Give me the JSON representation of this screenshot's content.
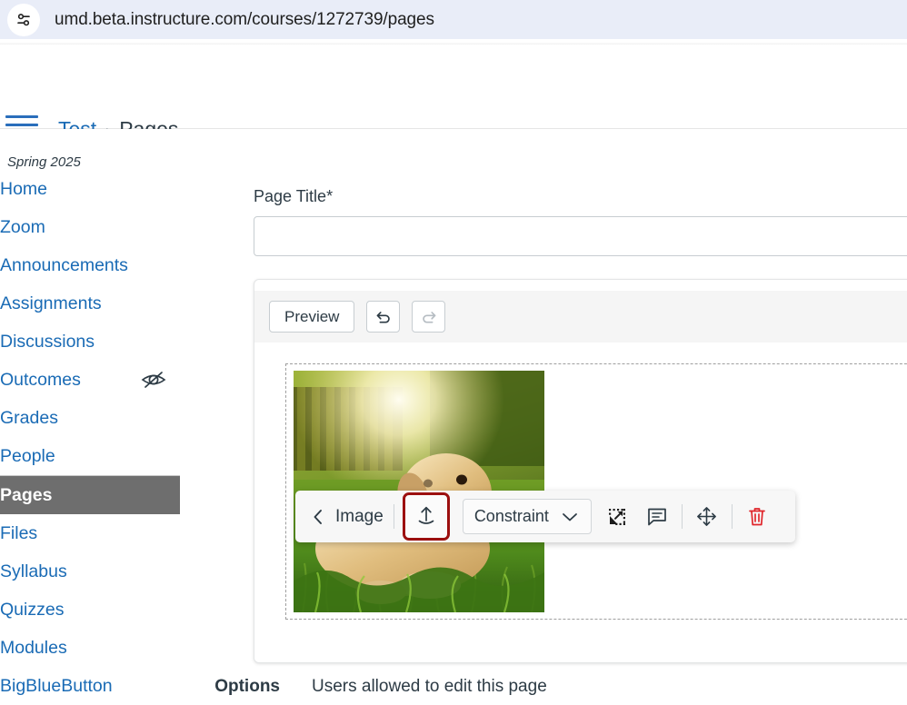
{
  "browser": {
    "site_settings_icon": "sliders-icon",
    "url": "umd.beta.instructure.com/courses/1272739/pages"
  },
  "header": {
    "menu_icon": "hamburger-icon",
    "breadcrumb": {
      "course": "Test",
      "separator": "›",
      "current": "Pages"
    }
  },
  "sidebar": {
    "term": "Spring 2025",
    "items": [
      {
        "label": "Home",
        "active": false,
        "hidden_icon": false
      },
      {
        "label": "Zoom",
        "active": false,
        "hidden_icon": false
      },
      {
        "label": "Announcements",
        "active": false,
        "hidden_icon": false
      },
      {
        "label": "Assignments",
        "active": false,
        "hidden_icon": false
      },
      {
        "label": "Discussions",
        "active": false,
        "hidden_icon": false
      },
      {
        "label": "Outcomes",
        "active": false,
        "hidden_icon": true
      },
      {
        "label": "Grades",
        "active": false,
        "hidden_icon": false
      },
      {
        "label": "People",
        "active": false,
        "hidden_icon": false
      },
      {
        "label": "Pages",
        "active": true,
        "hidden_icon": false
      },
      {
        "label": "Files",
        "active": false,
        "hidden_icon": false
      },
      {
        "label": "Syllabus",
        "active": false,
        "hidden_icon": false
      },
      {
        "label": "Quizzes",
        "active": false,
        "hidden_icon": false
      },
      {
        "label": "Modules",
        "active": false,
        "hidden_icon": false
      },
      {
        "label": "BigBlueButton",
        "active": false,
        "hidden_icon": false
      }
    ]
  },
  "main": {
    "page_title_label": "Page Title",
    "page_title_required_marker": "*",
    "page_title_value": "",
    "page_title_placeholder": "",
    "editor": {
      "toolbar": {
        "preview_label": "Preview",
        "undo_icon": "undo-icon",
        "redo_icon": "redo-icon"
      },
      "content": {
        "image_alt": "Golden retriever lying in sunlit grass"
      }
    },
    "image_toolbar": {
      "back_icon": "chevron-left-icon",
      "title": "Image",
      "upload_icon": "upload-icon",
      "upload_highlighted": true,
      "highlight_color": "#9c1010",
      "constraint_label": "Constraint",
      "constraint_chevron_icon": "chevron-down-icon",
      "resize_icon": "resize-icon",
      "alt_text_icon": "comment-icon",
      "move_icon": "move-icon",
      "delete_icon": "trash-icon",
      "delete_color": "#e0262b"
    },
    "options": {
      "label": "Options",
      "text": "Users allowed to edit this page"
    }
  },
  "colors": {
    "link": "#1a6bb5",
    "active_nav_bg": "#6e6e6e",
    "urlbar_bg": "#e9edf8",
    "text": "#2d3b45"
  }
}
